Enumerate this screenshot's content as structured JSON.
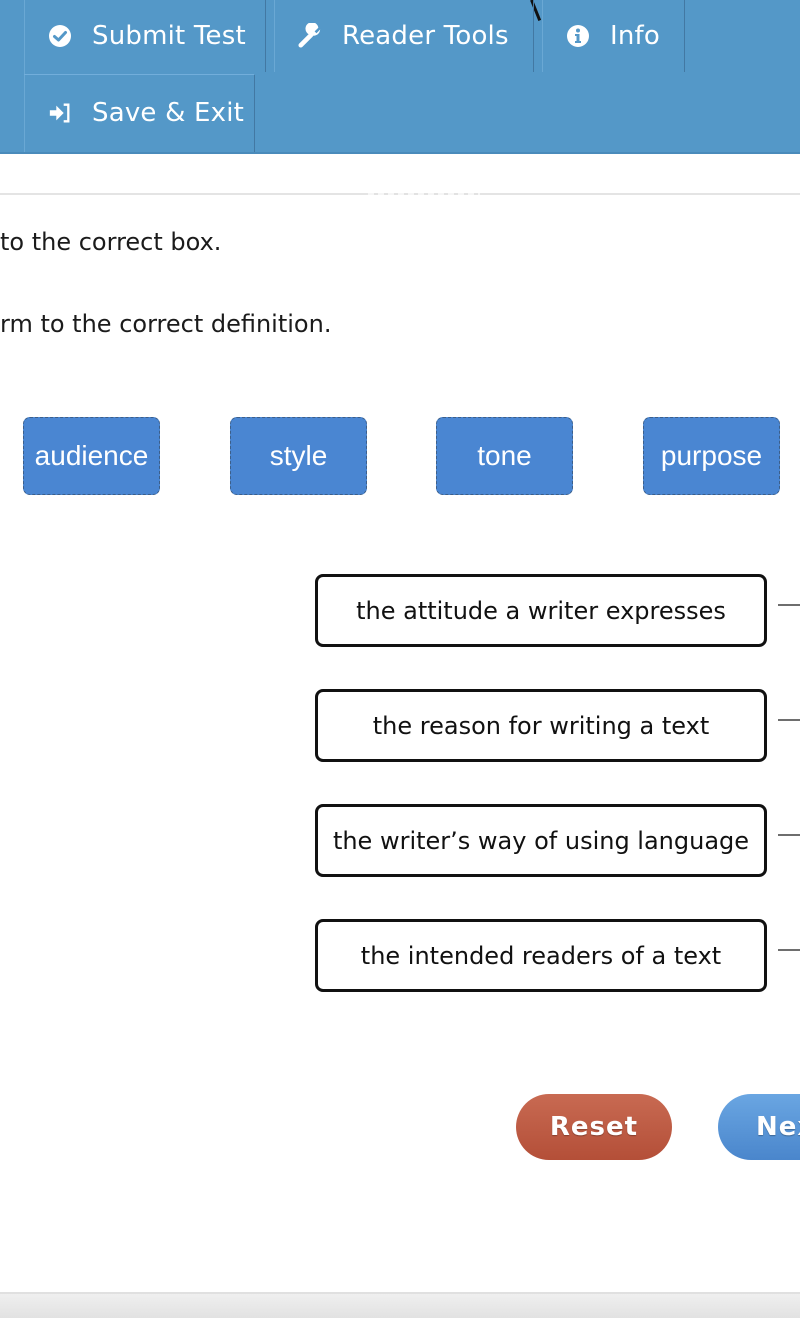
{
  "toolbar": {
    "submit_test": {
      "label": "Submit Test",
      "icon": "check-circle-icon"
    },
    "reader_tools": {
      "label": "Reader Tools",
      "icon": "wrench-icon"
    },
    "info": {
      "label": "Info",
      "icon": "info-circle-icon"
    },
    "save_exit": {
      "label": "Save & Exit",
      "icon": "sign-in-icon"
    },
    "background_color": "#5498c8"
  },
  "instructions": {
    "line1": "to the correct box.",
    "line2": "rm to the correct definition."
  },
  "terms": [
    {
      "label": "audience"
    },
    {
      "label": "style"
    },
    {
      "label": "tone"
    },
    {
      "label": "purpose"
    }
  ],
  "definitions": [
    {
      "text": "the attitude a writer expresses"
    },
    {
      "text": "the reason for writing a text"
    },
    {
      "text": "the writer’s way of using language"
    },
    {
      "text": "the intended readers of a text"
    }
  ],
  "actions": {
    "reset": {
      "label": "Reset",
      "color": "#b9553d"
    },
    "next": {
      "label": "Next",
      "visible_label": "Ne",
      "color": "#5592d6"
    }
  },
  "colors": {
    "term_tile": "#4a86d2"
  }
}
